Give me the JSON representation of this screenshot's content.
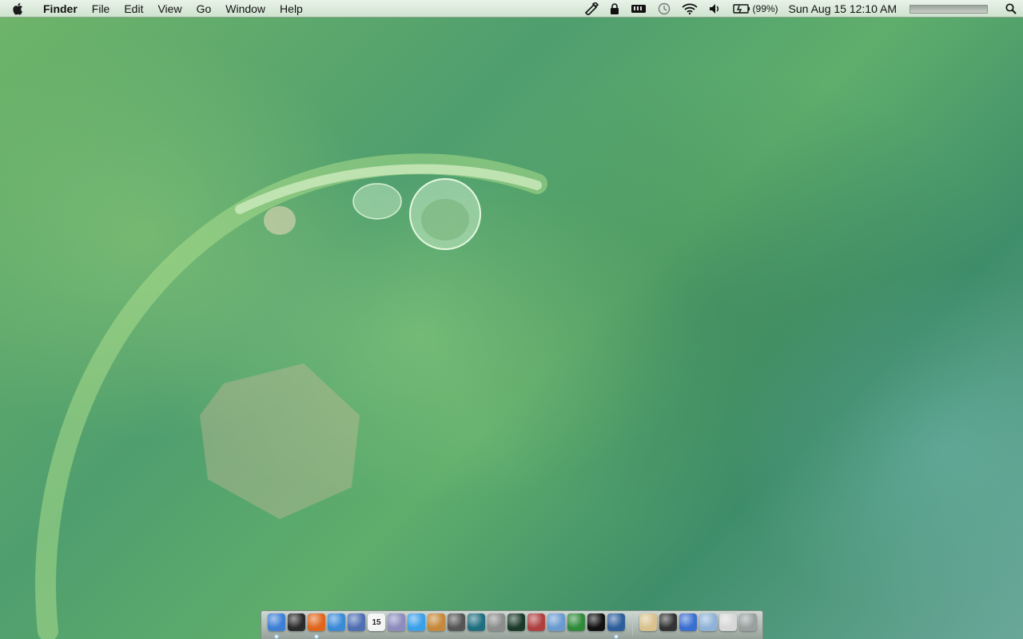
{
  "menubar": {
    "app_name": "Finder",
    "menus": [
      "File",
      "Edit",
      "View",
      "Go",
      "Window",
      "Help"
    ],
    "status_icons": [
      "script-icon",
      "lock-icon",
      "memory-icon",
      "time-machine-icon",
      "wifi-icon",
      "volume-icon",
      "battery-icon"
    ],
    "battery_percent": "(99%)",
    "datetime": "Sun Aug 15  12:10 AM"
  },
  "dock": {
    "apps": [
      {
        "name": "finder-icon",
        "color": "#3d7fd6"
      },
      {
        "name": "dashboard-icon",
        "color": "#2b2b2b"
      },
      {
        "name": "firefox-icon",
        "color": "#e0661e"
      },
      {
        "name": "safari-icon",
        "color": "#3a8ad8"
      },
      {
        "name": "mail-stamp-icon",
        "color": "#4f6fb3"
      },
      {
        "name": "ical-icon",
        "color": "#f4f4f4",
        "glyph": "15"
      },
      {
        "name": "preview-icon",
        "color": "#8c8cbf"
      },
      {
        "name": "itunes-icon",
        "color": "#3aa0e8"
      },
      {
        "name": "iphoto-icon",
        "color": "#c6883a"
      },
      {
        "name": "star-icon",
        "color": "#555555"
      },
      {
        "name": "time-machine-dock-icon",
        "color": "#1f6f80"
      },
      {
        "name": "system-preferences-icon",
        "color": "#8d8d8d"
      },
      {
        "name": "activity-monitor-icon",
        "color": "#1c3a2a"
      },
      {
        "name": "text-editor-icon",
        "color": "#b04040"
      },
      {
        "name": "utility-icon",
        "color": "#6a9ad0"
      },
      {
        "name": "globe-icon",
        "color": "#2f8a3a"
      },
      {
        "name": "terminal-icon",
        "color": "#111111"
      },
      {
        "name": "screenshot-icon",
        "color": "#2d5e9c"
      }
    ],
    "stacks": [
      {
        "name": "documents-stack-icon",
        "color": "#d9c28e"
      },
      {
        "name": "downloads-stack-icon",
        "color": "#333333"
      },
      {
        "name": "web-stack-icon",
        "color": "#3a6fd0"
      },
      {
        "name": "applications-folder-icon",
        "color": "#8fb3d8"
      },
      {
        "name": "pictures-stack-icon",
        "color": "#d8d8d8"
      },
      {
        "name": "trash-icon",
        "color": "#9aa0a0"
      }
    ],
    "running": [
      "finder-icon",
      "firefox-icon",
      "screenshot-icon"
    ]
  }
}
